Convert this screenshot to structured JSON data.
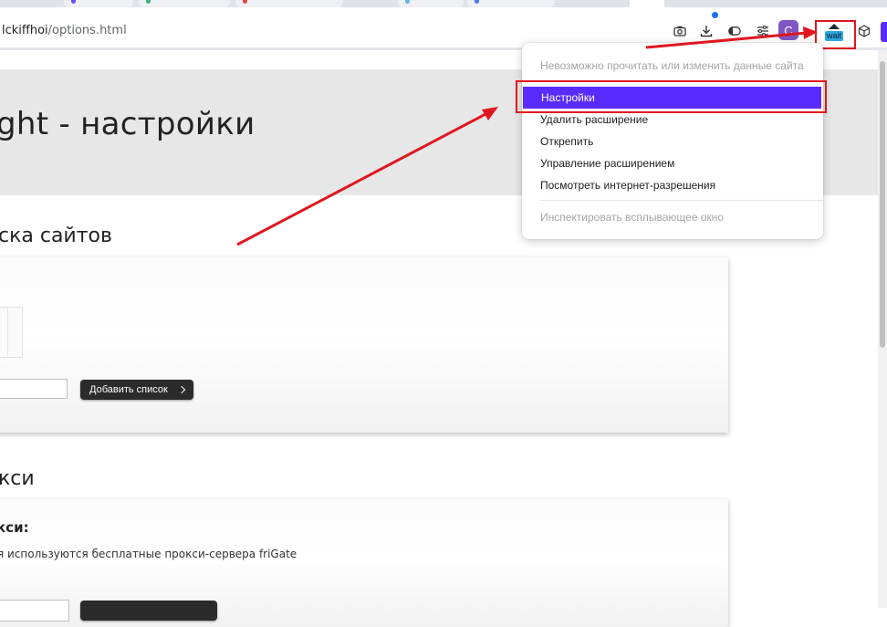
{
  "browser": {
    "url_host": "lckiffhoi",
    "url_path": "/options.html",
    "profile_initial": "C",
    "extension_badge": "wait",
    "icons": [
      "camera-icon",
      "download-icon",
      "reading-mode-icon",
      "tab-search-icon",
      "extensions-cube-icon"
    ]
  },
  "page": {
    "title": "ght - настройки",
    "section1_title": "ска сайтов",
    "add_list_button": "Добавить список",
    "section2_title": "кси",
    "proxy_subtitle": "кси:",
    "proxy_description": "я используются бесплатные прокси-сервера friGate"
  },
  "context_menu": {
    "items": [
      {
        "label": "Невозможно прочитать или изменить данные сайта",
        "state": "disabled"
      },
      {
        "label": "Настройки",
        "state": "selected"
      },
      {
        "label": "Удалить расширение",
        "state": "normal"
      },
      {
        "label": "Открепить",
        "state": "normal"
      },
      {
        "label": "Управление расширением",
        "state": "normal"
      },
      {
        "label": "Посмотреть интернет-разрешения",
        "state": "normal"
      },
      {
        "label": "Инспектировать всплывающее окно",
        "state": "disabled"
      }
    ]
  },
  "colors": {
    "accent": "#5a2bff",
    "annotation_red": "#e0161f",
    "profile": "#7e57c2",
    "badge": "#2ba7e0"
  }
}
